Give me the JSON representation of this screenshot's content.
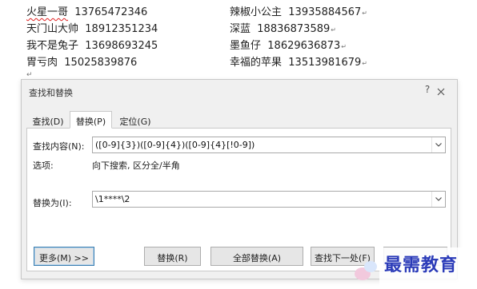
{
  "document": {
    "left_column": [
      {
        "name": "火星一哥",
        "phone": "13765472346"
      },
      {
        "name": "天门山大帅",
        "phone": "18912351234"
      },
      {
        "name": "我不是兔子",
        "phone": "13698693245"
      },
      {
        "name": "胃亏肉",
        "phone": "15025839876"
      }
    ],
    "right_column": [
      {
        "name": "辣椒小公主",
        "phone": "13935884567"
      },
      {
        "name": "深蓝",
        "phone": "18836873589"
      },
      {
        "name": "墨鱼仔",
        "phone": "18629636873"
      },
      {
        "name": "幸福的苹果",
        "phone": "13513981679"
      }
    ],
    "paragraph_mark": "↵"
  },
  "dialog": {
    "title": "查找和替换",
    "help": "?",
    "tabs": [
      {
        "label": "查找(D)"
      },
      {
        "label": "替换(P)",
        "active": true
      },
      {
        "label": "定位(G)"
      }
    ],
    "find_label": "查找内容(N):",
    "find_value": "([0-9]{3})([0-9]{4})([0-9]{4}[!0-9])",
    "options_label": "选项:",
    "options_value": "向下搜索, 区分全/半角",
    "replace_label": "替换为(I):",
    "replace_value": "\\1****\\2",
    "buttons": {
      "more": "更多(M) >>",
      "replace": "替换(R)",
      "replace_all": "全部替换(A)",
      "find_next": "查找下一处(F)"
    }
  },
  "watermark": "最需教育",
  "colors": {
    "dialog_bg": "#f0f0f0",
    "focus_border": "#3c7fb1",
    "watermark": "#2b3bb8",
    "spell_underline": "#e02020"
  }
}
